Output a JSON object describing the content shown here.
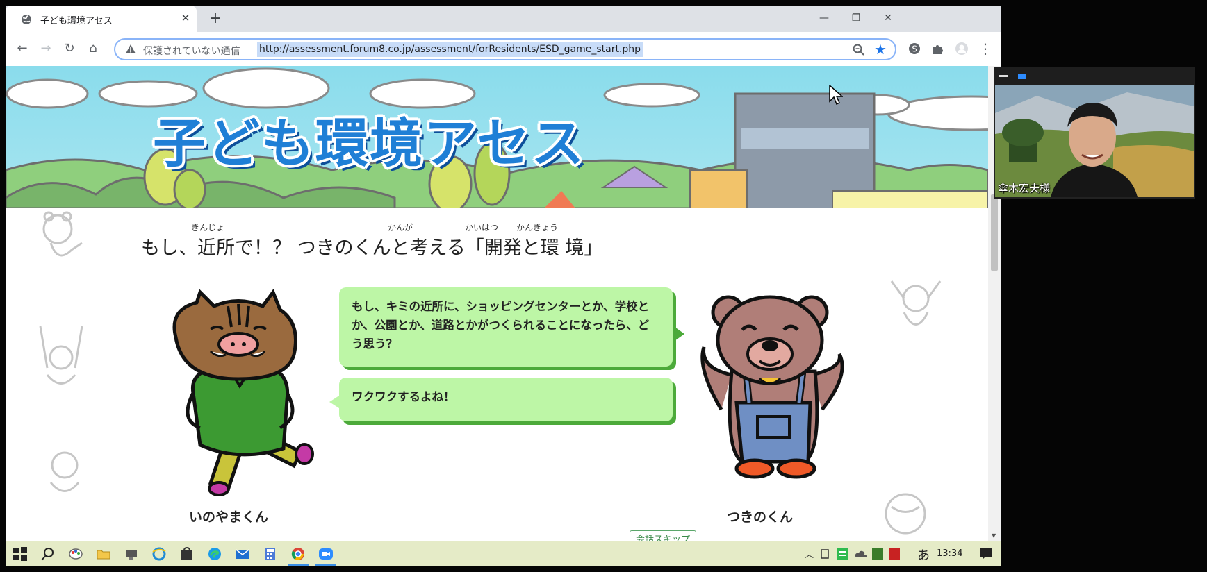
{
  "browser": {
    "tab_title": "子ども環境アセス",
    "new_tab_label": "+",
    "tab_close_label": "✕",
    "security_text": "保護されていない通信",
    "url": "http://assessment.forum8.co.jp/assessment/forResidents/ESD_game_start.php",
    "window_controls": {
      "minimize": "—",
      "maximize": "❐",
      "close": "✕"
    },
    "nav": {
      "back": "←",
      "forward": "→",
      "reload": "↻",
      "home": "⌂"
    },
    "star": "★"
  },
  "page": {
    "banner_title": "子ども環境アセス",
    "heading": {
      "text": "もし、近所で！？ つきのくんと考える「開発と環 境」",
      "ruby": {
        "kinjo": "きんじょ",
        "kanga": "かんが",
        "kaihatsu": "かいはつ",
        "kankyou": "かんきょう"
      }
    },
    "dialogue": {
      "line1": "もし、キミの近所に、ショッピングセンターとか、学校とか、公園とか、道路とかがつくられることになったら、どう思う？",
      "line2": "ワクワクするよね！"
    },
    "characters": {
      "left_name": "いのやまくん",
      "right_name": "つきのくん"
    },
    "skip_button": "会話スキップ"
  },
  "video": {
    "participant_name": "傘木宏夫様"
  },
  "taskbar": {
    "clock": "13:34",
    "ime": "あ"
  },
  "colors": {
    "bubble": "#bdf6a6",
    "bubble_shadow": "#4caa3a",
    "banner_title": "#1f7fd6",
    "sky": "#8adcec",
    "taskbar": "#e5ebc7"
  }
}
